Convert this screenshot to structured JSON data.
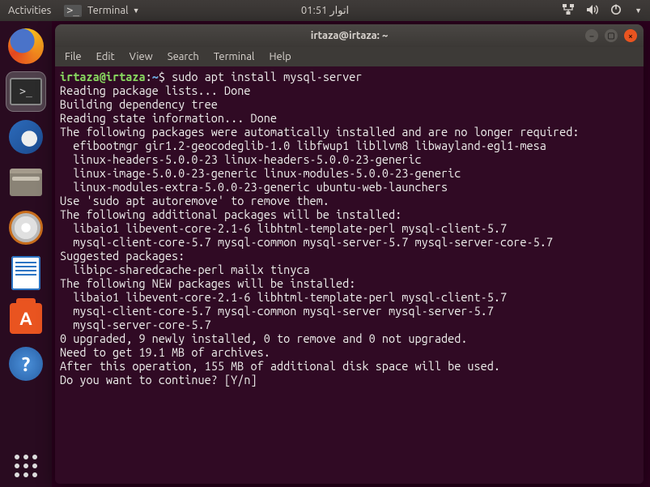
{
  "topbar": {
    "activities": "Activities",
    "app_indicator": "Terminal",
    "clock": "اتوار 01:51"
  },
  "dock": {
    "items": [
      {
        "name": "firefox-icon"
      },
      {
        "name": "terminal-icon"
      },
      {
        "name": "thunderbird-icon"
      },
      {
        "name": "files-icon"
      },
      {
        "name": "rhythmbox-icon"
      },
      {
        "name": "writer-icon"
      },
      {
        "name": "software-icon"
      },
      {
        "name": "help-icon"
      }
    ]
  },
  "window": {
    "title": "irtaza@irtaza: ~",
    "menu": [
      "File",
      "Edit",
      "View",
      "Search",
      "Terminal",
      "Help"
    ]
  },
  "terminal": {
    "prompt_user": "irtaza@irtaza",
    "prompt_colon": ":",
    "prompt_path": "~",
    "prompt_symbol": "$ ",
    "command": "sudo apt install mysql-server",
    "lines": [
      "Reading package lists... Done",
      "Building dependency tree",
      "Reading state information... Done",
      "The following packages were automatically installed and are no longer required:",
      "  efibootmgr gir1.2-geocodeglib-1.0 libfwup1 libllvm8 libwayland-egl1-mesa",
      "  linux-headers-5.0.0-23 linux-headers-5.0.0-23-generic",
      "  linux-image-5.0.0-23-generic linux-modules-5.0.0-23-generic",
      "  linux-modules-extra-5.0.0-23-generic ubuntu-web-launchers",
      "Use 'sudo apt autoremove' to remove them.",
      "The following additional packages will be installed:",
      "  libaio1 libevent-core-2.1-6 libhtml-template-perl mysql-client-5.7",
      "  mysql-client-core-5.7 mysql-common mysql-server-5.7 mysql-server-core-5.7",
      "Suggested packages:",
      "  libipc-sharedcache-perl mailx tinyca",
      "The following NEW packages will be installed:",
      "  libaio1 libevent-core-2.1-6 libhtml-template-perl mysql-client-5.7",
      "  mysql-client-core-5.7 mysql-common mysql-server mysql-server-5.7",
      "  mysql-server-core-5.7",
      "0 upgraded, 9 newly installed, 0 to remove and 0 not upgraded.",
      "Need to get 19.1 MB of archives.",
      "After this operation, 155 MB of additional disk space will be used.",
      "Do you want to continue? [Y/n]"
    ]
  }
}
